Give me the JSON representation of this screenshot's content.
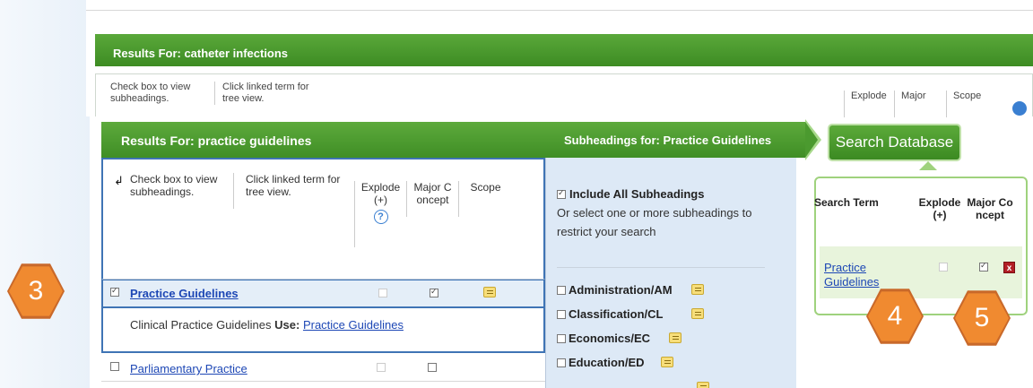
{
  "background_screen": {
    "header": "Results For: catheter infections",
    "hint_check": "Check box to view subheadings.",
    "hint_link": "Click linked term for tree view.",
    "col_explode": "Explode",
    "col_major": "Major",
    "col_scope": "Scope"
  },
  "results": {
    "header": "Results For: practice guidelines",
    "hint_arrow": "↲",
    "hint_check": "Check box to view subheadings.",
    "hint_link": "Click linked term for tree view.",
    "col_explode": "Explode (+)",
    "col_explode_help": "?",
    "col_major": "Major C oncept",
    "col_scope": "Scope",
    "selected_term": "Practice Guidelines",
    "use_prefix": "Clinical Practice Guidelines",
    "use_label": "Use:",
    "use_link": "Practice Guidelines",
    "row3_term": "Parliamentary Practice"
  },
  "subheadings": {
    "header": "Subheadings for: Practice Guidelines",
    "include_all": "Include All Subheadings",
    "instructions": "Or select one or more subheadings to restrict your search",
    "items": [
      "Administration/AM",
      "Classification/CL",
      "Economics/EC",
      "Education/ED"
    ]
  },
  "search_panel": {
    "button": "Search Database",
    "col_term": "Search Term",
    "col_explode": "Explode (+)",
    "col_major": "Major Co ncept",
    "term": "Practice Guidelines",
    "delete_label": "x"
  },
  "callouts": {
    "c3": "3",
    "c4": "4",
    "c5": "5"
  },
  "colors": {
    "header_green": "#4b9a2f",
    "selection_blue": "#3f74b5",
    "subheading_panel": "#dde9f6",
    "callout_orange": "#f08a30",
    "link_blue": "#1d47b5"
  }
}
